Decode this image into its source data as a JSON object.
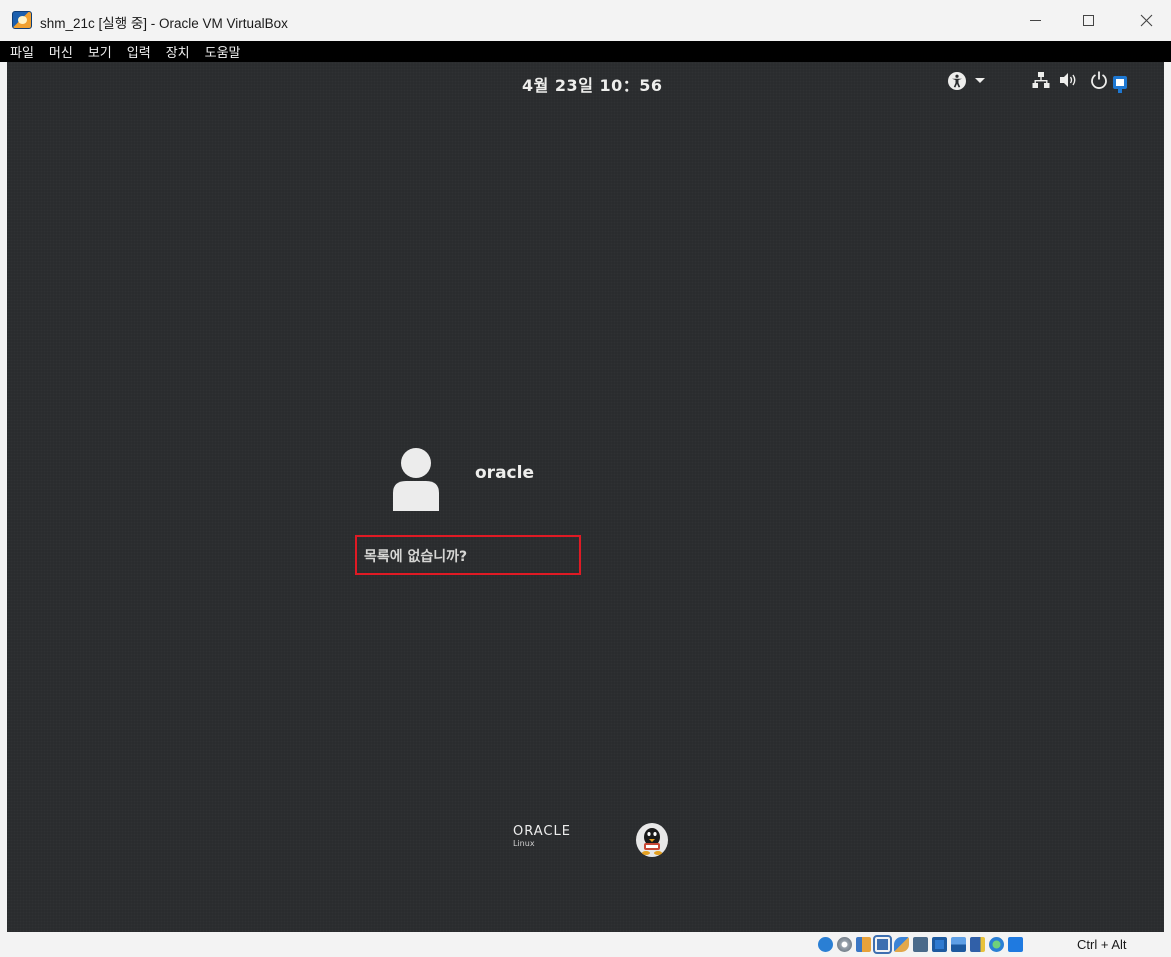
{
  "window": {
    "title": "shm_21c [실행 중] - Oracle VM VirtualBox"
  },
  "menu": {
    "items": [
      "파일",
      "머신",
      "보기",
      "입력",
      "장치",
      "도움말"
    ]
  },
  "top_bar": {
    "clock": "4월 23일 10：56",
    "icons": [
      "accessibility-icon",
      "dropdown-arrow-icon",
      "network-icon",
      "volume-icon",
      "power-icon",
      "notification-icon"
    ]
  },
  "login": {
    "username": "oracle",
    "not_listed": "목록에 없습니까?",
    "highlight_color": "#e01a24"
  },
  "branding": {
    "oracle": "ORACLE",
    "linux": "Linux"
  },
  "statusbar": {
    "icons": [
      "disk-icon",
      "optical-icon",
      "audio-icon",
      "network-adapter-icon",
      "usb-icon",
      "shared-folder-icon",
      "display-icon",
      "recording-icon",
      "vm-icon",
      "cpu-icon",
      "keyboard-capture-icon"
    ],
    "host_key": "Ctrl + Alt"
  },
  "colors": {
    "guest_background": "#2a2c2e",
    "menubar_background": "#000000",
    "accent_blue": "#1e78d2"
  }
}
